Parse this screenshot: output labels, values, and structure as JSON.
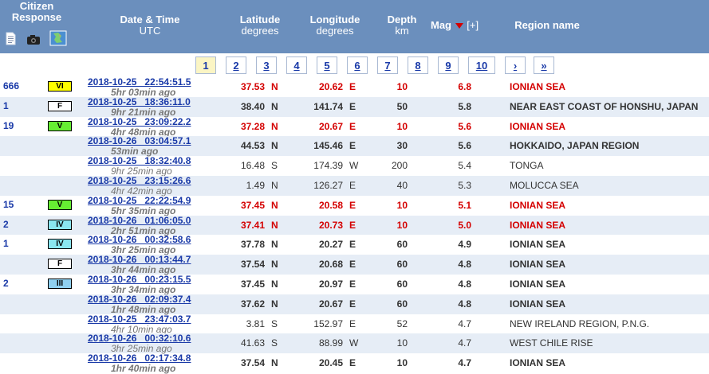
{
  "header": {
    "citizen_line1": "Citizen",
    "citizen_line2": "Response",
    "datetime_title": "Date & Time",
    "datetime_sub": "UTC",
    "lat_title": "Latitude",
    "lat_sub": "degrees",
    "lon_title": "Longitude",
    "lon_sub": "degrees",
    "depth_title": "Depth",
    "depth_sub": "km",
    "mag_title": "Mag",
    "mag_plus": "[+]",
    "region_title": "Region name",
    "icons": [
      "document-icon",
      "camera-icon",
      "map-icon"
    ],
    "colors": {
      "header_bg": "#6b8fbd",
      "alt_row": "#e6edf6",
      "link": "#1a3aa8",
      "highlight": "#d40000"
    }
  },
  "pager": {
    "pages": [
      "1",
      "2",
      "3",
      "4",
      "5",
      "6",
      "7",
      "8",
      "9",
      "10",
      "›",
      "»"
    ],
    "active": "1"
  },
  "rows": [
    {
      "count": "666",
      "intensity": "VI",
      "intensity_color": "#ffff00",
      "datetime": "2018-10-25   22:54:51.5",
      "ago": "5hr 03min ago",
      "lat": "37.53",
      "ns": "N",
      "lon": "20.62",
      "ew": "E",
      "depth": "10",
      "mag": "6.8",
      "region": "IONIAN SEA",
      "highlight": true,
      "bold": true,
      "ago_bold": true
    },
    {
      "count": "1",
      "intensity": "F",
      "intensity_color": "#ffffff",
      "datetime": "2018-10-25   18:36:11.0",
      "ago": "9hr 21min ago",
      "lat": "38.40",
      "ns": "N",
      "lon": "141.74",
      "ew": "E",
      "depth": "50",
      "mag": "5.8",
      "region": "NEAR EAST COAST OF HONSHU, JAPAN",
      "highlight": false,
      "bold": true,
      "ago_bold": true
    },
    {
      "count": "19",
      "intensity": "V",
      "intensity_color": "#66ee33",
      "datetime": "2018-10-25   23:09:22.2",
      "ago": "4hr 48min ago",
      "lat": "37.28",
      "ns": "N",
      "lon": "20.67",
      "ew": "E",
      "depth": "10",
      "mag": "5.6",
      "region": "IONIAN SEA",
      "highlight": true,
      "bold": true,
      "ago_bold": true
    },
    {
      "count": "",
      "intensity": "",
      "intensity_color": "",
      "datetime": "2018-10-26   03:04:57.1",
      "ago": "53min ago",
      "lat": "44.53",
      "ns": "N",
      "lon": "145.46",
      "ew": "E",
      "depth": "30",
      "mag": "5.6",
      "region": "HOKKAIDO, JAPAN REGION",
      "highlight": false,
      "bold": true,
      "ago_bold": true
    },
    {
      "count": "",
      "intensity": "",
      "intensity_color": "",
      "datetime": "2018-10-25   18:32:40.8",
      "ago": "9hr 25min ago",
      "lat": "16.48",
      "ns": "S",
      "lon": "174.39",
      "ew": "W",
      "depth": "200",
      "mag": "5.4",
      "region": "TONGA",
      "highlight": false,
      "bold": false,
      "ago_bold": false
    },
    {
      "count": "",
      "intensity": "",
      "intensity_color": "",
      "datetime": "2018-10-25   23:15:26.6",
      "ago": "4hr 42min ago",
      "lat": "1.49",
      "ns": "N",
      "lon": "126.27",
      "ew": "E",
      "depth": "40",
      "mag": "5.3",
      "region": "MOLUCCA SEA",
      "highlight": false,
      "bold": false,
      "ago_bold": false
    },
    {
      "count": "15",
      "intensity": "V",
      "intensity_color": "#66ee33",
      "datetime": "2018-10-25   22:22:54.9",
      "ago": "5hr 35min ago",
      "lat": "37.45",
      "ns": "N",
      "lon": "20.58",
      "ew": "E",
      "depth": "10",
      "mag": "5.1",
      "region": "IONIAN SEA",
      "highlight": true,
      "bold": true,
      "ago_bold": true
    },
    {
      "count": "2",
      "intensity": "IV",
      "intensity_color": "#8ae6f0",
      "datetime": "2018-10-26   01:06:05.0",
      "ago": "2hr 51min ago",
      "lat": "37.41",
      "ns": "N",
      "lon": "20.73",
      "ew": "E",
      "depth": "10",
      "mag": "5.0",
      "region": "IONIAN SEA",
      "highlight": true,
      "bold": true,
      "ago_bold": true
    },
    {
      "count": "1",
      "intensity": "IV",
      "intensity_color": "#8ae6f0",
      "datetime": "2018-10-26   00:32:58.6",
      "ago": "3hr 25min ago",
      "lat": "37.78",
      "ns": "N",
      "lon": "20.27",
      "ew": "E",
      "depth": "60",
      "mag": "4.9",
      "region": "IONIAN SEA",
      "highlight": false,
      "bold": true,
      "ago_bold": true
    },
    {
      "count": "",
      "intensity": "F",
      "intensity_color": "#ffffff",
      "datetime": "2018-10-26   00:13:44.7",
      "ago": "3hr 44min ago",
      "lat": "37.54",
      "ns": "N",
      "lon": "20.68",
      "ew": "E",
      "depth": "60",
      "mag": "4.8",
      "region": "IONIAN SEA",
      "highlight": false,
      "bold": true,
      "ago_bold": true
    },
    {
      "count": "2",
      "intensity": "III",
      "intensity_color": "#8fd0f0",
      "datetime": "2018-10-26   00:23:15.5",
      "ago": "3hr 34min ago",
      "lat": "37.45",
      "ns": "N",
      "lon": "20.97",
      "ew": "E",
      "depth": "60",
      "mag": "4.8",
      "region": "IONIAN SEA",
      "highlight": false,
      "bold": true,
      "ago_bold": true
    },
    {
      "count": "",
      "intensity": "",
      "intensity_color": "",
      "datetime": "2018-10-26   02:09:37.4",
      "ago": "1hr 48min ago",
      "lat": "37.62",
      "ns": "N",
      "lon": "20.67",
      "ew": "E",
      "depth": "60",
      "mag": "4.8",
      "region": "IONIAN SEA",
      "highlight": false,
      "bold": true,
      "ago_bold": true
    },
    {
      "count": "",
      "intensity": "",
      "intensity_color": "",
      "datetime": "2018-10-25   23:47:03.7",
      "ago": "4hr 10min ago",
      "lat": "3.81",
      "ns": "S",
      "lon": "152.97",
      "ew": "E",
      "depth": "52",
      "mag": "4.7",
      "region": "NEW IRELAND REGION, P.N.G.",
      "highlight": false,
      "bold": false,
      "ago_bold": false
    },
    {
      "count": "",
      "intensity": "",
      "intensity_color": "",
      "datetime": "2018-10-26   00:32:10.6",
      "ago": "3hr 25min ago",
      "lat": "41.63",
      "ns": "S",
      "lon": "88.99",
      "ew": "W",
      "depth": "10",
      "mag": "4.7",
      "region": "WEST CHILE RISE",
      "highlight": false,
      "bold": false,
      "ago_bold": false
    },
    {
      "count": "",
      "intensity": "",
      "intensity_color": "",
      "datetime": "2018-10-26   02:17:34.8",
      "ago": "1hr 40min ago",
      "lat": "37.54",
      "ns": "N",
      "lon": "20.45",
      "ew": "E",
      "depth": "10",
      "mag": "4.7",
      "region": "IONIAN SEA",
      "highlight": false,
      "bold": true,
      "ago_bold": true
    }
  ]
}
